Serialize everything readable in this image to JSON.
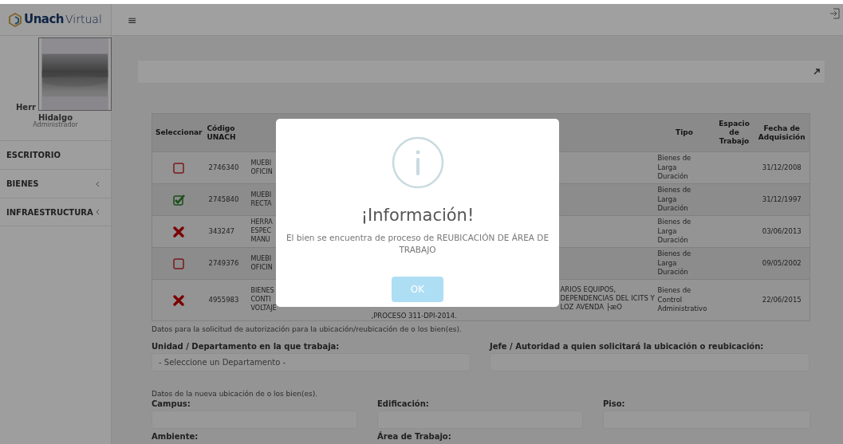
{
  "sidebar": {
    "logo": {
      "bold": "Unach",
      "light": "Virtual"
    },
    "user": {
      "name_lines": [
        "Herr",
        "Hidalgo"
      ],
      "role": "Administrador"
    },
    "menu": [
      {
        "label": "ESCRITORIO",
        "has_submenu": false
      },
      {
        "label": "BIENES",
        "has_submenu": true
      },
      {
        "label": "INFRAESTRUCTURA",
        "has_submenu": true
      }
    ]
  },
  "header": {
    "menu_toggle": "≡"
  },
  "table": {
    "columns": [
      "Seleccionar",
      "Código UNACH",
      "Tipo",
      "Espacio de Trabajo",
      "Fecha de Adquisición"
    ],
    "rows": [
      {
        "kind": "checkbox",
        "checked": false,
        "code": "2746340",
        "column_3": "MUEBI\nOFICIN",
        "tipo": "Bienes de\nLarga\nDuración",
        "fecha": "31/12/2008"
      },
      {
        "kind": "checkbox",
        "checked": true,
        "code": "2745840",
        "column_3": "MUEBI\nRECTA",
        "tipo": "Bienes de\nLarga\nDuración",
        "fecha": "31/12/1997"
      },
      {
        "kind": "blocked",
        "code": "343247",
        "column_3": "HERRA\nESPEC\nMANU",
        "tipo": "Bienes de\nLarga\nDuración",
        "fecha": "03/06/2013"
      },
      {
        "kind": "checkbox",
        "checked": false,
        "code": "2749376",
        "column_3": "MUEBI\nOFICIN",
        "tipo": "Bienes de\nLarga\nDuración",
        "fecha": "09/05/2002"
      },
      {
        "kind": "blocked",
        "code": "4955983",
        "column_3": "BIENES\nCONTI\nVOLTAJE",
        "column_4": [
          "ARIOS EQUIPOS,",
          "DEPENDENCIAS DEL ICITS Y",
          "LOZ AVENDA ├æO",
          ",PROCESO 311-DPI-2014."
        ],
        "tipo": "Bienes de\nControl\nAdministrativo",
        "fecha": "22/06/2015"
      }
    ]
  },
  "request": {
    "intro": "Datos para la solicitud de autorización para la ubicación/reubicación de o los bien(es).",
    "fields": [
      {
        "label": "Unidad / Departamento en la que trabaja:",
        "value": "- Seleccione un Departamento -"
      },
      {
        "label": "Jefe / Autoridad a quien solicitará la ubicación o reubicación:"
      }
    ]
  },
  "location": {
    "intro": "Datos de la nueva ubicación de o los bien(es).",
    "fields": [
      {
        "label": "Campus:",
        "kind": "select"
      },
      {
        "label": "Edificación:",
        "kind": "select"
      },
      {
        "label": "Piso:",
        "kind": "select"
      },
      {
        "label": "Ambiente:",
        "kind": "label"
      },
      {
        "label": "Área de Trabajo:",
        "kind": "label"
      }
    ]
  },
  "modal": {
    "title": "¡Información!",
    "text": "El bien se encuentra de proceso de REUBICACIÓN DE ÁREA DE TRABAJO",
    "button": "OK"
  }
}
